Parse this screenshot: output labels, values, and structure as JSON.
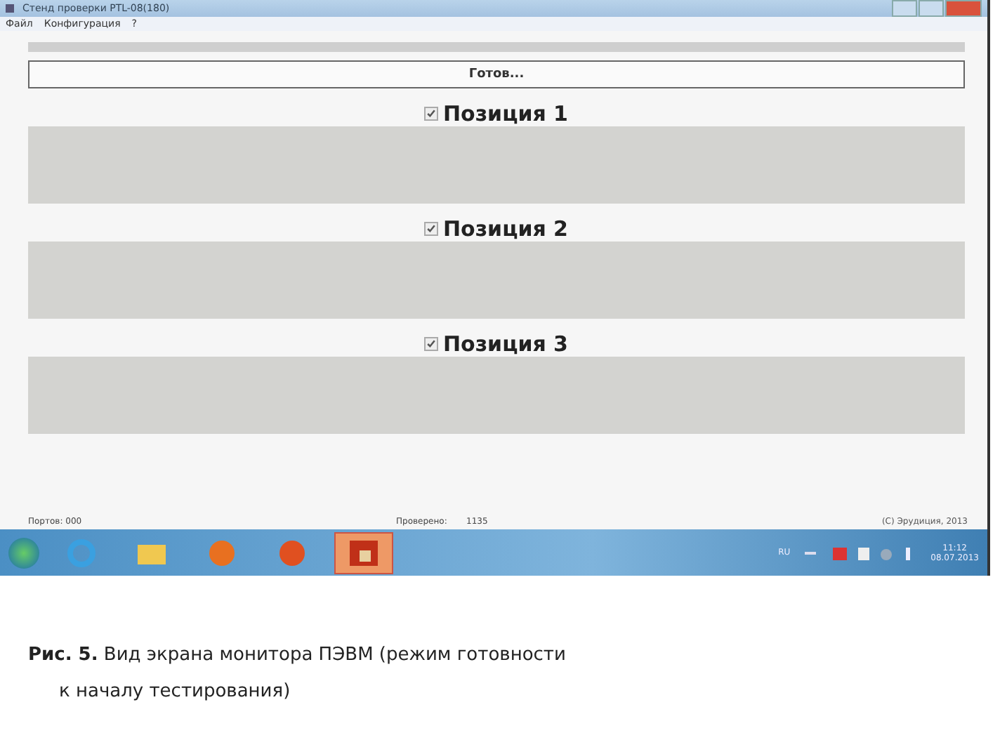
{
  "window": {
    "title": "Стенд проверки PTL-08(180)"
  },
  "menu": [
    {
      "label": "Файл"
    },
    {
      "label": "Конфигурация"
    },
    {
      "label": "?"
    }
  ],
  "progress": {
    "level": 0
  },
  "status_button": {
    "label": "Готов..."
  },
  "positions": [
    {
      "label": "Позиция 1",
      "checked": true
    },
    {
      "label": "Позиция 2",
      "checked": true
    },
    {
      "label": "Позиция 3",
      "checked": true
    }
  ],
  "status_bar": {
    "ports": "Портов: 000",
    "checked_label": "Проверено:",
    "checked_value": "1135",
    "copyright": "(C) Эрудиция, 2013"
  },
  "taskbar": {
    "language": "RU",
    "time": "11:12",
    "date": "08.07.2013"
  },
  "caption": {
    "text": "**Рис. 5.** Вид экрана монитора ПЭВМ (режим готовности",
    "continuation": "к началу тестирования)"
  }
}
